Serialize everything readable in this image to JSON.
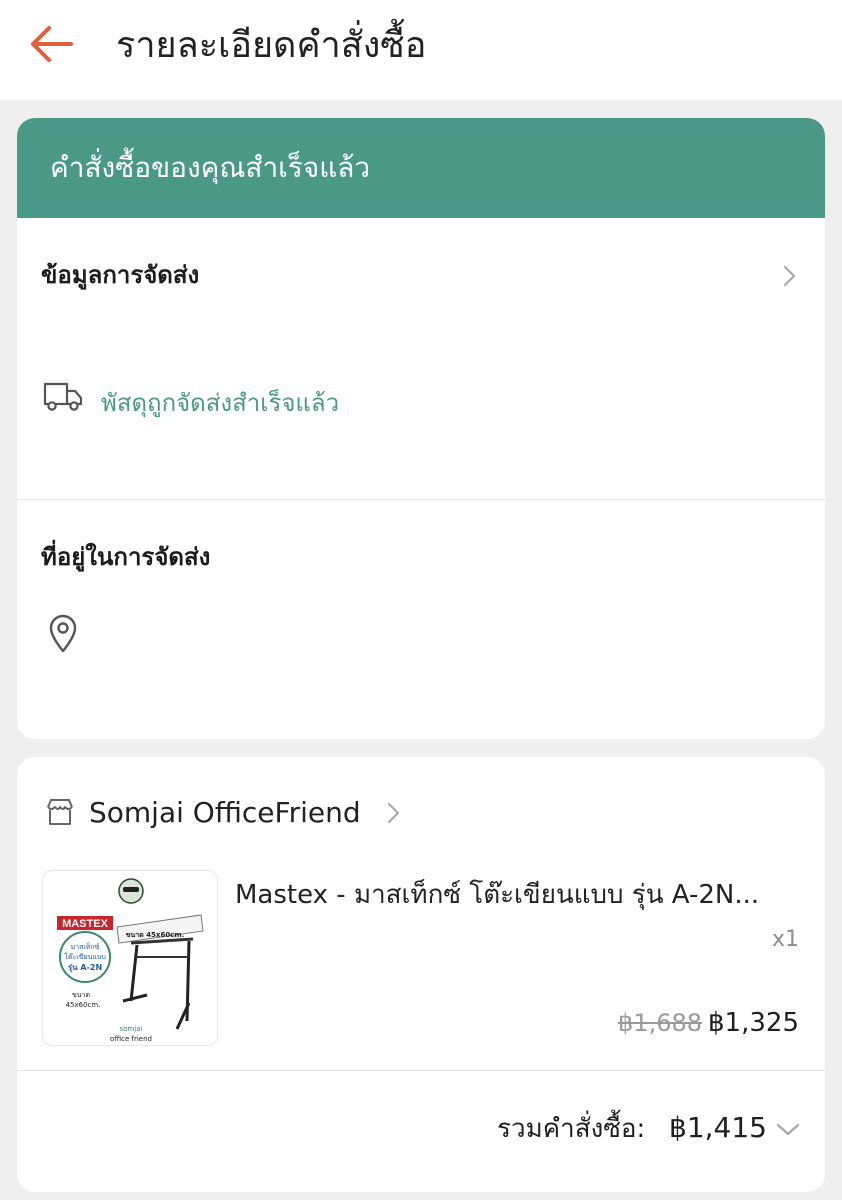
{
  "header": {
    "title": "รายละเอียดคำสั่งซื้อ"
  },
  "status": {
    "banner_text": "คำสั่งซื้อของคุณสำเร็จแล้ว",
    "banner_color": "#4a9987"
  },
  "shipping": {
    "label": "ข้อมูลการจัดส่ง",
    "status_text": "พัสดุถูกจัดส่งสำเร็จแล้ว",
    "status_color": "#4a9987"
  },
  "address": {
    "label": "ที่อยู่ในการจัดส่ง"
  },
  "shop": {
    "name": "Somjai OfficeFriend"
  },
  "product": {
    "name": "Mastex - มาสเท็กซ์ โต๊ะเขียนแบบ รุ่น A-2N...",
    "quantity": "x1",
    "original_price": "฿1,688",
    "price": "฿1,325",
    "image": {
      "brand": "MASTEX",
      "badge_line1": "มาสเท็กซ์",
      "badge_line2": "โต๊ะเขียนแบบ",
      "badge_line3": "รุ่น A-2N",
      "size_top": "ขนาด 45x60cm.",
      "size_left1": "ขนาด",
      "size_left2": "45x60cm.",
      "shop_line1": "somjai",
      "shop_line2": "office friend"
    }
  },
  "order_total": {
    "label": "รวมคำสั่งซื้อ:",
    "value": "฿1,415"
  },
  "icons": {
    "back": "arrow-left-icon",
    "shipping_chevron": "chevron-right-icon",
    "truck": "truck-icon",
    "pin": "location-pin-icon",
    "store": "store-icon",
    "shop_chevron": "chevron-right-icon",
    "total_chevron": "chevron-down-icon"
  },
  "colors": {
    "accent_back_arrow": "#e0603c",
    "teal": "#4a9987"
  }
}
